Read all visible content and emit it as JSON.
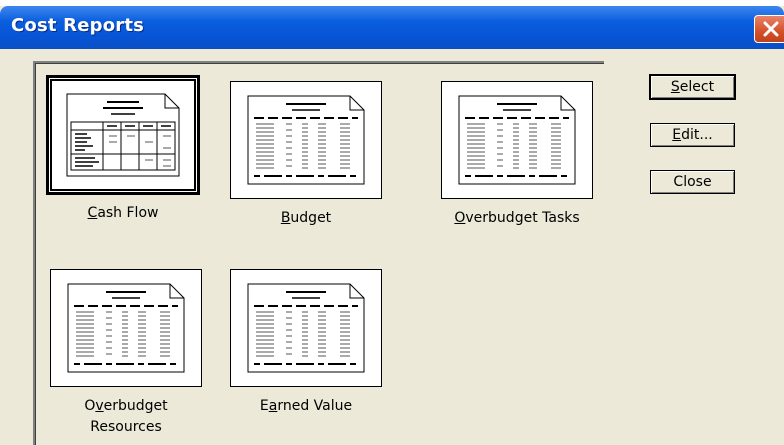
{
  "window": {
    "title": "Cost Reports",
    "close_icon": "close-x-icon",
    "accent_color": "#0a5fdf",
    "face_color": "#ece9d8"
  },
  "reports": [
    {
      "label_mnemonic": "C",
      "label_rest": "ash Flow",
      "selected": true,
      "icon": "crosstab-report-icon"
    },
    {
      "label_mnemonic": "B",
      "label_rest": "udget",
      "selected": false,
      "icon": "table-report-icon"
    },
    {
      "label_mnemonic": "O",
      "label_rest": "verbudget Tasks",
      "selected": false,
      "icon": "table-report-icon"
    },
    {
      "label_pre": "O",
      "label_mnemonic": "v",
      "label_rest": "erbudget",
      "label_line2": "Resources",
      "selected": false,
      "icon": "table-report-icon"
    },
    {
      "label_pre": "E",
      "label_mnemonic": "a",
      "label_rest": "rned Value",
      "selected": false,
      "icon": "table-report-icon"
    }
  ],
  "buttons": {
    "select": {
      "mnemonic": "S",
      "rest": "elect"
    },
    "edit": {
      "mnemonic": "E",
      "rest": "dit..."
    },
    "close": {
      "label": "Close"
    }
  }
}
